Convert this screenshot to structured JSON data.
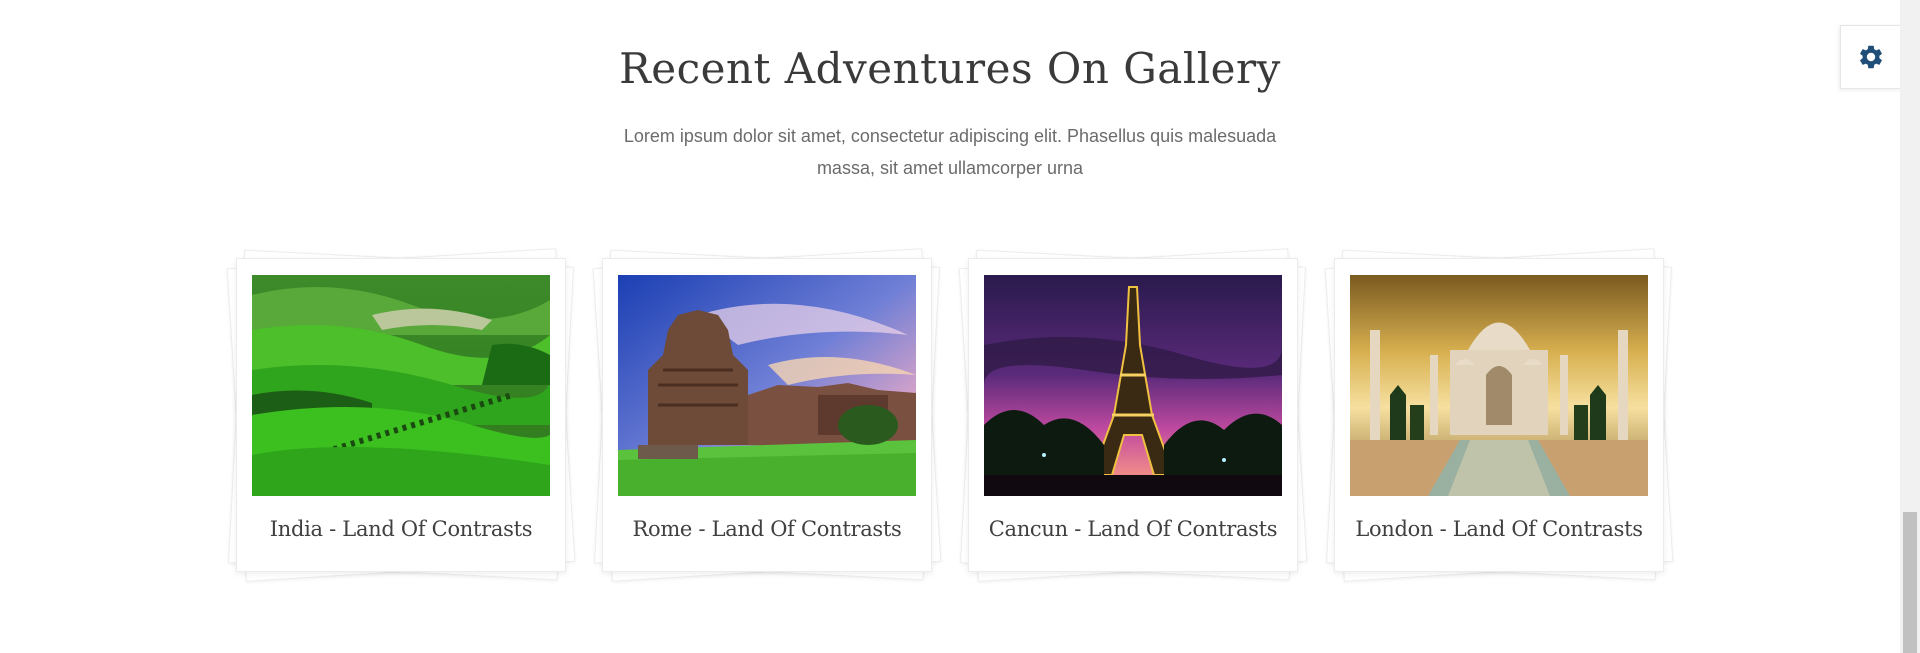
{
  "section": {
    "title": "Recent Adventures On Gallery",
    "subtitle_line1": "Lorem ipsum dolor sit amet, consectetur adipiscing elit. Phasellus quis malesuada",
    "subtitle_line2": "massa, sit amet ullamcorper urna"
  },
  "gallery": {
    "items": [
      {
        "caption": "India - Land Of Contrasts",
        "image": "green-hills-landscape"
      },
      {
        "caption": "Rome - Land Of Contrasts",
        "image": "ancient-temple-ruins"
      },
      {
        "caption": "Cancun - Land Of Contrasts",
        "image": "eiffel-tower-dusk"
      },
      {
        "caption": "London - Land Of Contrasts",
        "image": "taj-mahal-sunset"
      }
    ]
  },
  "settings": {
    "icon": "gear-icon",
    "color": "#1f4e79"
  },
  "colors": {
    "title": "#3a3a3a",
    "subtitle": "#6b6b6b",
    "caption": "#404040"
  }
}
